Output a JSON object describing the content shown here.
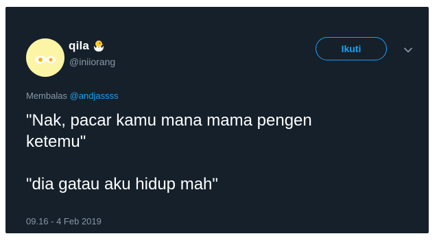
{
  "tweet": {
    "author": {
      "display_name": "qila",
      "name_emoji_icon": "hatching-chick-icon",
      "handle": "@iniiorang",
      "avatar_icon": "fried-eggs-avatar"
    },
    "follow_label": "Ikuti",
    "menu_icon": "chevron-down-icon",
    "reply": {
      "prefix": "Membalas",
      "handle": "@andjassss"
    },
    "text": {
      "line1": "\"Nak, pacar kamu mana mama pengen",
      "line2": "ketemu\"",
      "line3": "\"dia gatau aku hidup mah\""
    },
    "timestamp": "09.16 - 4 Feb 2019"
  },
  "colors": {
    "background": "#15202b",
    "accent": "#1da1f2",
    "secondary_text": "#8899a6",
    "primary_text": "#ffffff"
  }
}
